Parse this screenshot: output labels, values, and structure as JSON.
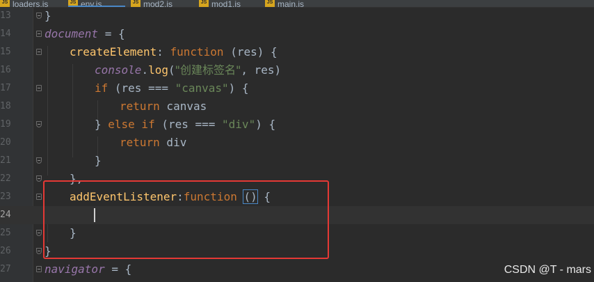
{
  "tabs": [
    {
      "label": "loaders.js",
      "active": false
    },
    {
      "label": "env.js",
      "active": true
    },
    {
      "label": "mod2.js",
      "active": false
    },
    {
      "label": "mod1.js",
      "active": false
    },
    {
      "label": "main.js",
      "active": false
    }
  ],
  "line_numbers": [
    "13",
    "14",
    "15",
    "16",
    "17",
    "18",
    "19",
    "20",
    "21",
    "22",
    "23",
    "24",
    "25",
    "26",
    "27"
  ],
  "code": {
    "l13": "}",
    "l14_obj": "document",
    "l14_rest": " = {",
    "l15_fn": "createElement",
    "l15_colon": ": ",
    "l15_kw": "function",
    "l15_rest": " (res) {",
    "l16_obj": "console",
    "l16_dot": ".",
    "l16_fn": "log",
    "l16_open": "(",
    "l16_str": "\"创建标签名\"",
    "l16_rest": ", res)",
    "l17_kw": "if",
    "l17_mid": " (res === ",
    "l17_str": "\"canvas\"",
    "l17_rest": ") {",
    "l18_kw": "return",
    "l18_rest": " canvas",
    "l19_open": "} ",
    "l19_kw": "else if",
    "l19_mid": " (res === ",
    "l19_str": "\"div\"",
    "l19_rest": ") {",
    "l20_kw": "return",
    "l20_rest": " div",
    "l21": "}",
    "l22": "},",
    "l23_fn": "addEventListener",
    "l23_colon": ":",
    "l23_kw": "function",
    "l23_sp": " ",
    "l23_paren": "()",
    "l23_rest": " {",
    "l25": "}",
    "l26": "}",
    "l27_obj": "navigator",
    "l27_rest": " = {"
  },
  "watermark": "CSDN @T - mars",
  "colors": {
    "background": "#2b2b2b",
    "keyword": "#cc7832",
    "object": "#9876aa",
    "function": "#ffc66d",
    "string": "#6a8759",
    "annotation_box": "#e53935"
  }
}
